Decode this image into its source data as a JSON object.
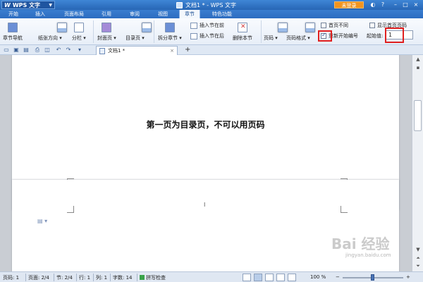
{
  "titlebar": {
    "app_logo": "W",
    "app_name": "WPS 文字",
    "window_title": "文档1 * - WPS 文字",
    "login_label": "未登录"
  },
  "menu_tabs": [
    "开始",
    "插入",
    "页面布局",
    "引用",
    "审阅",
    "视图",
    "章节",
    "特色功能"
  ],
  "active_tab": "章节",
  "ribbon": {
    "chapter_nav": "章节导航",
    "paper_orientation": "纸张方向 ▾",
    "columns": "分栏 ▾",
    "cover_page": "封面页 ▾",
    "toc_page": "目录页 ▾",
    "split_chapter": "拆分章节 ▾",
    "insert_before": "插入节在前",
    "insert_after": "插入节在后",
    "delete_section": "删除本节",
    "page_number": "页码 ▾",
    "page_number_format": "页码格式 ▾",
    "first_page_different": "首页不同",
    "show_first_page_number": "显示首页页码",
    "restart_numbering": "重新开始编号",
    "start_value_label": "起始值:",
    "start_value": "1"
  },
  "doc_tab": {
    "name": "文档1 *",
    "close": "×",
    "new_tab": "+"
  },
  "document": {
    "heading": "第一页为目录页，不可以用页码",
    "cursor": "I",
    "float_icon": "▤ ▾"
  },
  "statusbar": {
    "page_code": "页码: 1",
    "page": "页面: 2/4",
    "section": "节: 2/4",
    "line": "行: 1",
    "column": "列: 1",
    "word_count": "字数: 14",
    "spell_check": "拼写检查",
    "zoom": "100 %"
  },
  "watermark": {
    "text": "Bai 经验",
    "url": "jingyan.baidu.com"
  },
  "colors": {
    "title_blue": "#2c6cc0",
    "login_orange": "#f3941e",
    "highlight_red": "#e02020"
  }
}
